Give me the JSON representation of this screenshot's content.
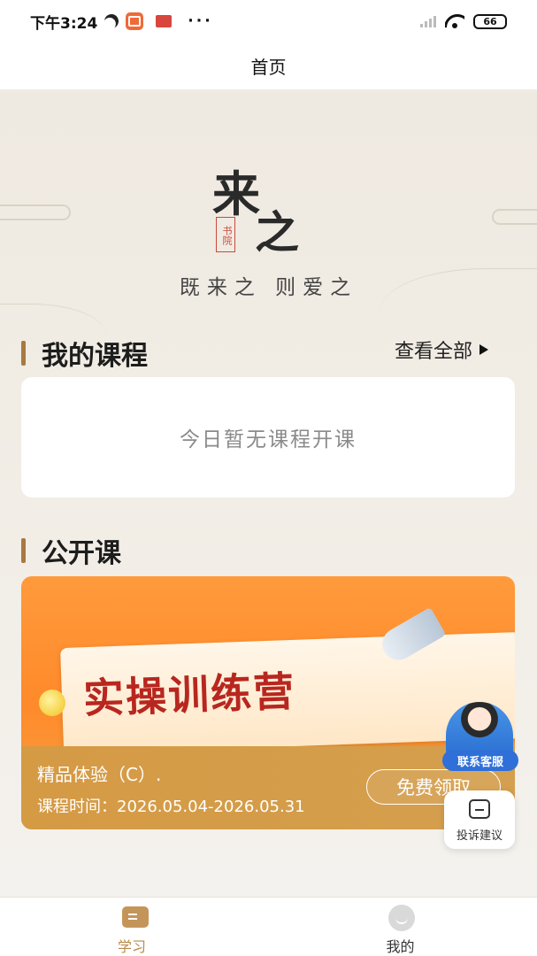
{
  "status_bar": {
    "time": "下午3:24",
    "dots": "···",
    "battery": "66",
    "icons": [
      "moon-icon",
      "app-notification-icon",
      "app-notification-icon-2",
      "signal-icon",
      "wifi-icon",
      "battery-icon"
    ]
  },
  "nav": {
    "title": "首页"
  },
  "brand": {
    "logo_main": "来",
    "logo_sub": "之",
    "seal": "书院",
    "slogan": "既来之 则爱之"
  },
  "my_courses": {
    "title": "我的课程",
    "view_all": "查看全部",
    "empty_text": "今日暂无课程开课"
  },
  "open_courses": {
    "title": "公开课",
    "items": [
      {
        "banner_title": "实操训练营",
        "name": "精品体验（C）.",
        "time": "课程时间：2026.05.04-2026.05.31",
        "action": "免费领取"
      }
    ]
  },
  "floating": {
    "service_label": "联系客服",
    "feedback_label": "投诉建议"
  },
  "tab_bar": {
    "tabs": [
      {
        "label": "学习",
        "active": true
      },
      {
        "label": "我的",
        "active": false
      }
    ],
    "active_color": "#b98a4b"
  },
  "colors": {
    "accent": "#a9793f",
    "banner_orange": "#ff8a2a",
    "banner_title_red": "#b8271f",
    "service_blue": "#2f6fd8"
  }
}
